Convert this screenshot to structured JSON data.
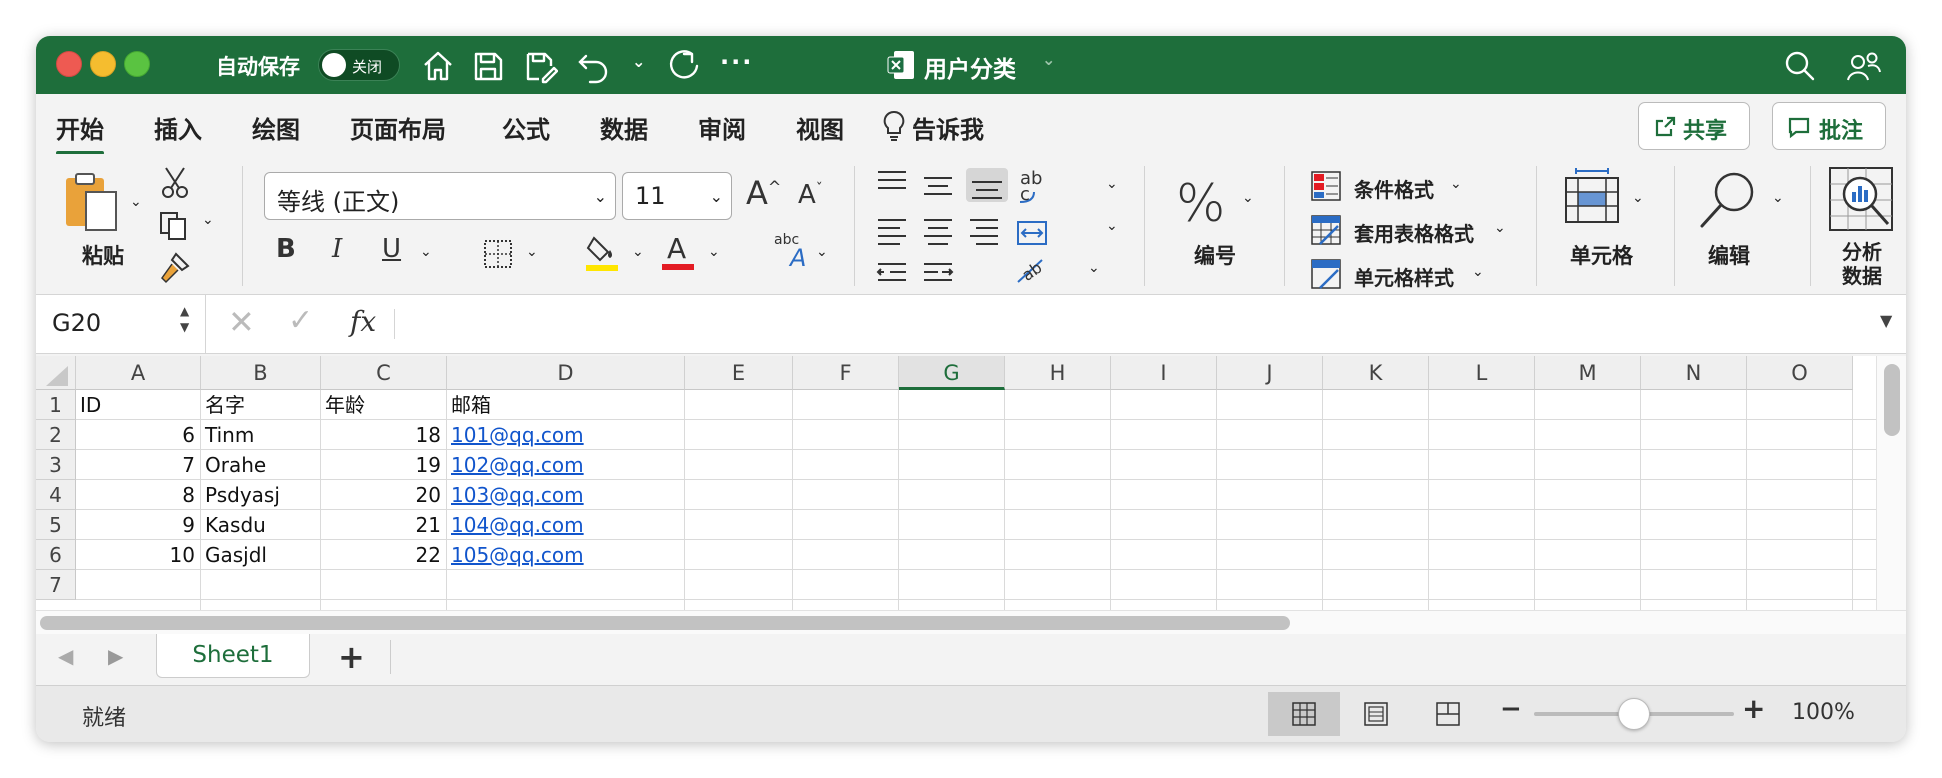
{
  "title_bar": {
    "autosave_label": "自动保存",
    "autosave_toggle": "关闭",
    "document_title": "用户分类"
  },
  "menu": {
    "tabs": [
      "开始",
      "插入",
      "绘图",
      "页面布局",
      "公式",
      "数据",
      "审阅",
      "视图"
    ],
    "tell_me": "告诉我",
    "share": "共享",
    "comments": "批注"
  },
  "ribbon": {
    "paste_label": "粘贴",
    "font_name": "等线 (正文)",
    "font_size": "11",
    "number_label": "编号",
    "conditional_format": "条件格式",
    "format_as_table": "套用表格格式",
    "cell_styles": "单元格样式",
    "cells_label": "单元格",
    "edit_label": "编辑",
    "analyze_label_1": "分析",
    "analyze_label_2": "数据"
  },
  "formula_bar": {
    "name_box": "G20",
    "fx": "fx",
    "content": ""
  },
  "sheet": {
    "columns": [
      "A",
      "B",
      "C",
      "D",
      "E",
      "F",
      "G",
      "H",
      "I",
      "J",
      "K",
      "L",
      "M",
      "N",
      "O"
    ],
    "selected_column": "G",
    "rows": [
      "1",
      "2",
      "3",
      "4",
      "5",
      "6",
      "7"
    ],
    "header": {
      "A": "ID",
      "B": "名字",
      "C": "年龄",
      "D": "邮箱"
    },
    "data": [
      {
        "A": "6",
        "B": "Tinm",
        "C": "18",
        "D": "101@qq.com"
      },
      {
        "A": "7",
        "B": "Orahe",
        "C": "19",
        "D": "102@qq.com"
      },
      {
        "A": "8",
        "B": "Psdyasj",
        "C": "20",
        "D": "103@qq.com"
      },
      {
        "A": "9",
        "B": "Kasdu",
        "C": "21",
        "D": "104@qq.com"
      },
      {
        "A": "10",
        "B": "Gasjdl",
        "C": "22",
        "D": "105@qq.com"
      }
    ]
  },
  "sheet_tabs": {
    "active": "Sheet1",
    "add": "+"
  },
  "status_bar": {
    "status": "就绪",
    "zoom_minus": "−",
    "zoom_plus": "+",
    "zoom": "100%",
    "zoom_level": 1.0
  },
  "colors": {
    "brand_green": "#1e6e3b",
    "link_blue": "#1155cc"
  }
}
